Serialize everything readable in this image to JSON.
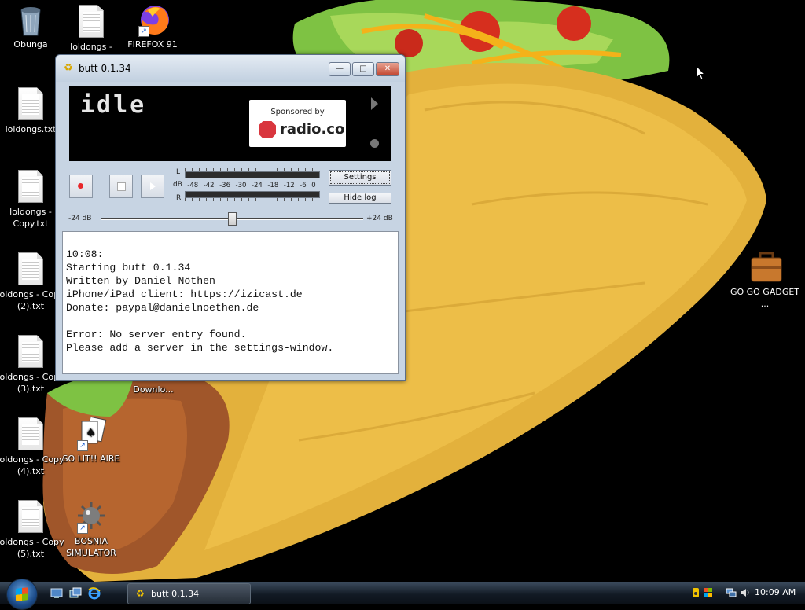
{
  "desktop": {
    "icons": [
      {
        "label": "Obunga",
        "type": "recycle-bin"
      },
      {
        "label": "loldongs -",
        "type": "file"
      },
      {
        "label": "FIREFOX 91",
        "type": "firefox"
      },
      {
        "label": "loldongs.txt",
        "type": "file"
      },
      {
        "label": "loldongs - Copy.txt",
        "type": "file"
      },
      {
        "label": "loldongs - Copy (2).txt",
        "type": "file"
      },
      {
        "label": "loldongs - Copy (3).txt",
        "type": "file"
      },
      {
        "label": "Downlo...",
        "type": "folder"
      },
      {
        "label": "loldongs - Copy (4).txt",
        "type": "file"
      },
      {
        "label": "SO LIT!! AIRE",
        "type": "solitaire"
      },
      {
        "label": "loldongs - Copy (5).txt",
        "type": "file"
      },
      {
        "label": "BOSNIA SIMULATOR",
        "type": "mine"
      },
      {
        "label": "GO GO GADGET ...",
        "type": "briefcase"
      }
    ]
  },
  "window": {
    "title": "butt 0.1.34",
    "buttons": {
      "minimize": "—",
      "maximize": "□",
      "close": "✕"
    },
    "display": {
      "status": "idle",
      "sponsor_line": "Sponsored by",
      "sponsor_name": "radio.co"
    },
    "vu_meter": {
      "left_label": "L",
      "db_label": "dB",
      "right_label": "R",
      "scale": [
        "-48",
        "-42",
        "-36",
        "-30",
        "-24",
        "-18",
        "-12",
        "-6",
        "0"
      ]
    },
    "buttons_labels": {
      "settings": "Settings",
      "hide_log": "Hide log"
    },
    "gain": {
      "min_label": "-24 dB",
      "max_label": "+24 dB",
      "value_db": 0
    },
    "log": [
      "10:08:",
      "Starting butt 0.1.34",
      "Written by Daniel Nöthen",
      "iPhone/iPad client: https://izicast.de",
      "Donate: paypal@danielnoethen.de",
      "",
      "Error: No server entry found.",
      "Please add a server in the settings-window."
    ]
  },
  "taskbar": {
    "task_label": "butt 0.1.34",
    "clock": "10:09 AM"
  },
  "colors": {
    "record": "#e8282b",
    "sponsor_brand": "#d9363e",
    "close_button": "#c24630"
  }
}
